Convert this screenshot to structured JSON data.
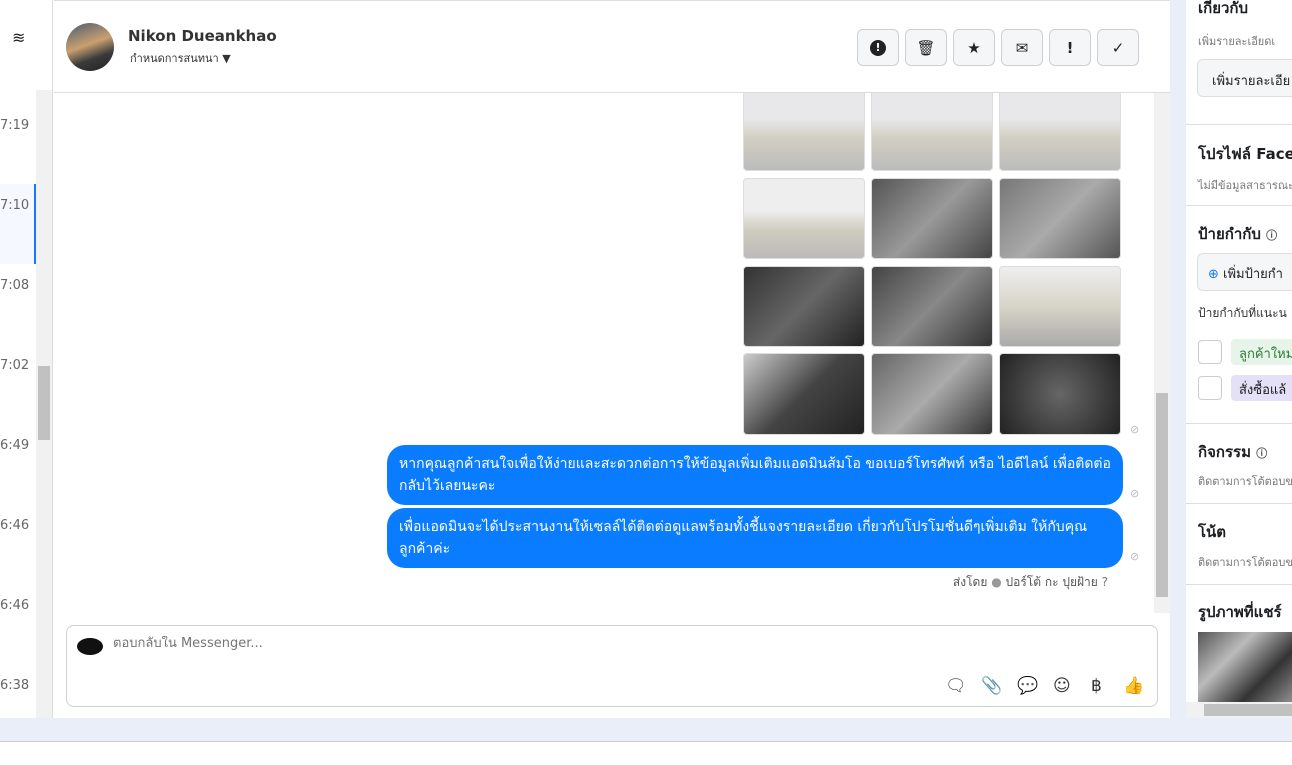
{
  "conversation_list": {
    "times": [
      "7:19",
      "7:10",
      "7:08",
      "7:02",
      "6:49",
      "6:46",
      "6:46",
      "6:38"
    ]
  },
  "header": {
    "name": "Nikon Dueankhao",
    "assign_label": "กำหนดการสนทนา",
    "actions": [
      {
        "icon": "alert-circle-icon",
        "glyph": "❗"
      },
      {
        "icon": "trash-icon",
        "glyph": "🗑"
      },
      {
        "icon": "star-icon",
        "glyph": "★"
      },
      {
        "icon": "envelope-icon",
        "glyph": "✉"
      },
      {
        "icon": "exclamation-icon",
        "glyph": "!"
      },
      {
        "icon": "check-icon",
        "glyph": "✓"
      }
    ]
  },
  "messages": [
    {
      "text": "หากคุณลูกค้าสนใจเพื่อให้ง่ายและสะดวกต่อการให้ข้อมูลเพิ่มเติมแอดมินส้มโอ ขอเบอร์โทรศัพท์ หรือ ไอดีไลน์ เพื่อติดต่อกลับไว้เลยนะคะ"
    },
    {
      "text": "เพื่อแอดมินจะได้ประสานงานให้เซลล์ได้ติดต่อดูแลพร้อมทั้งชี้แจงรายละเอียด เกี่ยวกับโปรโมชั่นดีๆเพิ่มเติม ให้กับคุณลูกค้าค่ะ"
    }
  ],
  "sent_by": {
    "prefix": "ส่งโดย",
    "name": "ปอร์โต้ กะ ปุยฝ้าย"
  },
  "composer": {
    "placeholder": "ตอบกลับใน Messenger..."
  },
  "sidebar": {
    "about": {
      "title": "เกี่ยวกับ",
      "subtitle": "เพิ่มรายละเอียดเ",
      "button": "เพิ่มรายละเอีย"
    },
    "facebook_profile": {
      "title": "โปรไฟล์ Face",
      "subtitle": "ไม่มีข้อมูลสาธารณะ"
    },
    "labels": {
      "title": "ป้ายกำกับ",
      "add_button": "เพิ่มป้ายกำ",
      "suggested": "ป้ายกำกับที่แนะน",
      "tags": [
        {
          "label": "ลูกค้าใหม",
          "color": "#e6f4ea",
          "text": "#2e7d32"
        },
        {
          "label": "สั่งซื้อแล้",
          "color": "#e4e0f7",
          "text": "#333"
        }
      ]
    },
    "activity": {
      "title": "กิจกรรม",
      "subtitle": "ติดตามการโต้ตอบข"
    },
    "notes": {
      "title": "โน้ต",
      "subtitle": "ติดตามการโต้ตอบข"
    },
    "shared_photos": {
      "title": "รูปภาพที่แชร์"
    }
  }
}
